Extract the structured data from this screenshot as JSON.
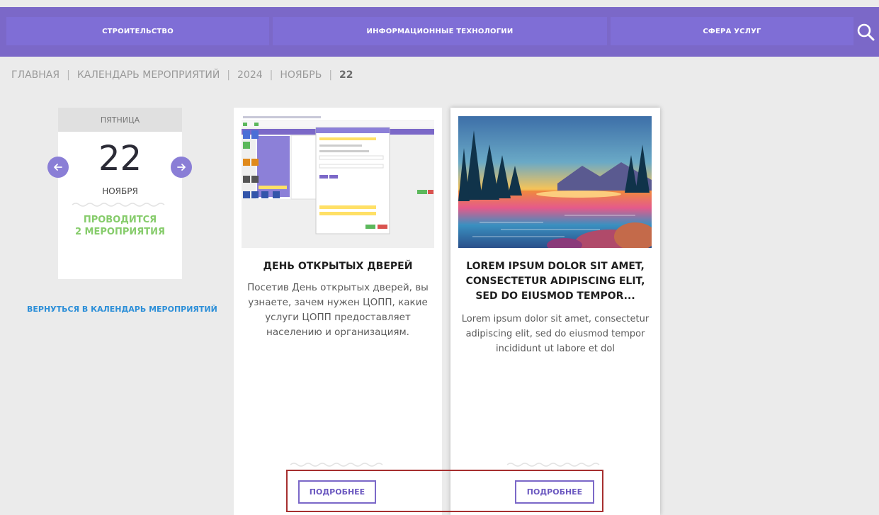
{
  "nav": {
    "items": [
      "СТРОИТЕЛЬСТВО",
      "ИНФОРМАЦИОННЫЕ ТЕХНОЛОГИИ",
      "СФЕРА УСЛУГ"
    ],
    "search_icon": "search-icon"
  },
  "breadcrumb": {
    "items": [
      "ГЛАВНАЯ",
      "КАЛЕНДАРЬ МЕРОПРИЯТИЙ",
      "2024",
      "НОЯБРЬ"
    ],
    "current": "22",
    "separator": "|"
  },
  "date_widget": {
    "weekday": "ПЯТНИЦА",
    "day": "22",
    "month": "НОЯБРЯ",
    "status_line1": "ПРОВОДИТСЯ",
    "status_line2": "2 МЕРОПРИЯТИЯ",
    "prev_icon": "arrow-left-icon",
    "next_icon": "arrow-right-icon"
  },
  "back_link": "ВЕРНУТЬСЯ В КАЛЕНДАРЬ МЕРОПРИЯТИЙ",
  "events": [
    {
      "title": "ДЕНЬ ОТКРЫТЫХ ДВЕРЕЙ",
      "description": "Посетив День открытых дверей, вы узнаете, зачем нужен ЦОПП, какие услуги ЦОПП предоставляет населению и организациям.",
      "button": "ПОДРОБНЕЕ",
      "image": "screenshot-thumbnail"
    },
    {
      "title": "LOREM IPSUM DOLOR SIT AMET, CONSECTETUR ADIPISCING ELIT, SED DO EIUSMOD TEMPOR...",
      "description": "Lorem ipsum dolor sit amet, consectetur adipiscing elit, sed do eiusmod tempor incididunt ut labore et dol",
      "button": "ПОДРОБНЕЕ",
      "image": "watercolor-lake-landscape"
    }
  ],
  "colors": {
    "nav_bg": "#7b68c8",
    "accent": "#7b68c8",
    "status_green": "#86cc6b",
    "link_blue": "#2d8fd8",
    "highlight_red": "#a62f2f"
  }
}
